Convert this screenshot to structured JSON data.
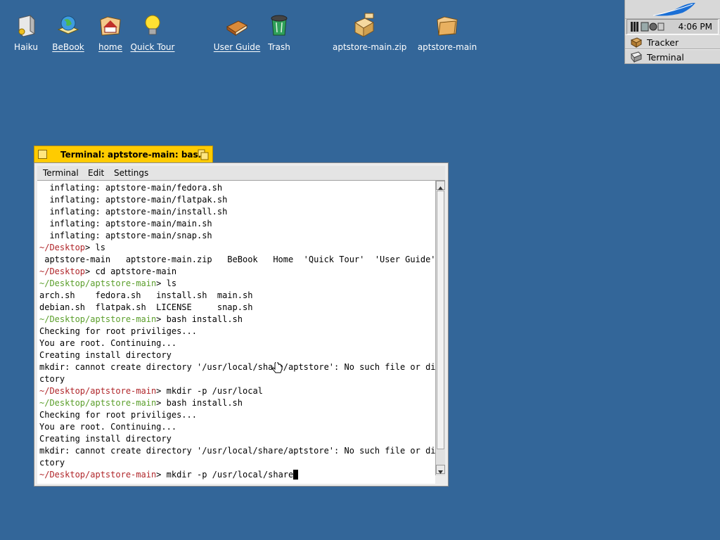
{
  "desktop": {
    "icons": [
      {
        "label": "Haiku",
        "icon": "haiku-drive-icon"
      },
      {
        "label": "BeBook",
        "icon": "globe-book-icon"
      },
      {
        "label": "home",
        "icon": "home-folder-icon"
      },
      {
        "label": "Quick Tour",
        "icon": "lightbulb-icon"
      },
      {
        "label": "User Guide",
        "icon": "book-icon"
      },
      {
        "label": "Trash",
        "icon": "trash-icon"
      },
      {
        "label": "aptstore-main.zip",
        "icon": "zip-archive-icon"
      },
      {
        "label": "aptstore-main",
        "icon": "folder-icon"
      }
    ]
  },
  "deskbar": {
    "clock": "4:06 PM",
    "apps": [
      {
        "label": "Tracker"
      },
      {
        "label": "Terminal"
      }
    ]
  },
  "terminal": {
    "title": "Terminal: aptstore-main: bash",
    "menu": [
      "Terminal",
      "Edit",
      "Settings"
    ],
    "lines": [
      {
        "text": "  inflating: aptstore-main/fedora.sh"
      },
      {
        "text": "  inflating: aptstore-main/flatpak.sh"
      },
      {
        "text": "  inflating: aptstore-main/install.sh"
      },
      {
        "text": "  inflating: aptstore-main/main.sh"
      },
      {
        "text": "  inflating: aptstore-main/snap.sh"
      },
      {
        "prompt": "~/Desktop",
        "color": "red",
        "cmd": "> ls"
      },
      {
        "text": " aptstore-main   aptstore-main.zip   BeBook   Home  'Quick Tour'  'User Guide'"
      },
      {
        "prompt": "~/Desktop",
        "color": "red",
        "cmd": "> cd aptstore-main"
      },
      {
        "prompt": "~/Desktop/aptstore-main",
        "color": "green",
        "cmd": "> ls"
      },
      {
        "text": "arch.sh    fedora.sh   install.sh  main.sh"
      },
      {
        "text": "debian.sh  flatpak.sh  LICENSE     snap.sh"
      },
      {
        "prompt": "~/Desktop/aptstore-main",
        "color": "green",
        "cmd": "> bash install.sh"
      },
      {
        "text": "Checking for root priviliges..."
      },
      {
        "text": "You are root. Continuing..."
      },
      {
        "text": "Creating install directory"
      },
      {
        "text": "mkdir: cannot create directory '/usr/local/share/aptstore': No such file or dire"
      },
      {
        "text": "ctory"
      },
      {
        "prompt": "~/Desktop/aptstore-main",
        "color": "red",
        "cmd": "> mkdir -p /usr/local"
      },
      {
        "prompt": "~/Desktop/aptstore-main",
        "color": "green",
        "cmd": "> bash install.sh"
      },
      {
        "text": "Checking for root priviliges..."
      },
      {
        "text": "You are root. Continuing..."
      },
      {
        "text": "Creating install directory"
      },
      {
        "text": "mkdir: cannot create directory '/usr/local/share/aptstore': No such file or dire"
      },
      {
        "text": "ctory"
      },
      {
        "prompt": "~/Desktop/aptstore-main",
        "color": "red",
        "cmd": "> mkdir -p /usr/local/share"
      }
    ]
  }
}
